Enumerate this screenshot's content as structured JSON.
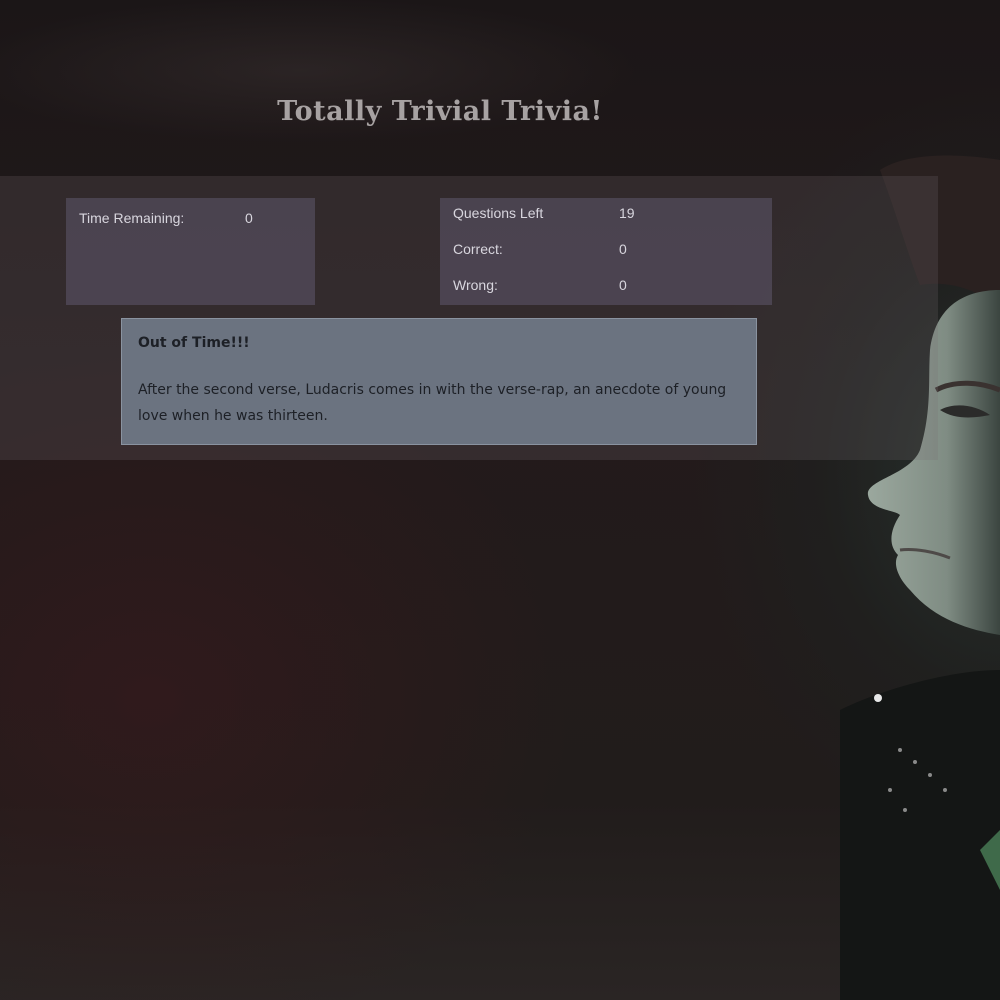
{
  "header": {
    "title": "Totally Trivial Trivia!"
  },
  "timer": {
    "label": "Time Remaining:",
    "value": "0"
  },
  "stats": {
    "questions_left_label": "Questions Left",
    "questions_left_value": "19",
    "correct_label": "Correct:",
    "correct_value": "0",
    "wrong_label": "Wrong:",
    "wrong_value": "0"
  },
  "message": {
    "title": "Out of Time!!!",
    "body": "After the second verse, Ludacris comes in with the verse-rap, an anecdote of young love when he was thirteen."
  },
  "colors": {
    "background": "#221b1c",
    "title_text": "#a7a2a2",
    "panel_bg": "#5f586e",
    "message_bg": "#6b7380"
  }
}
